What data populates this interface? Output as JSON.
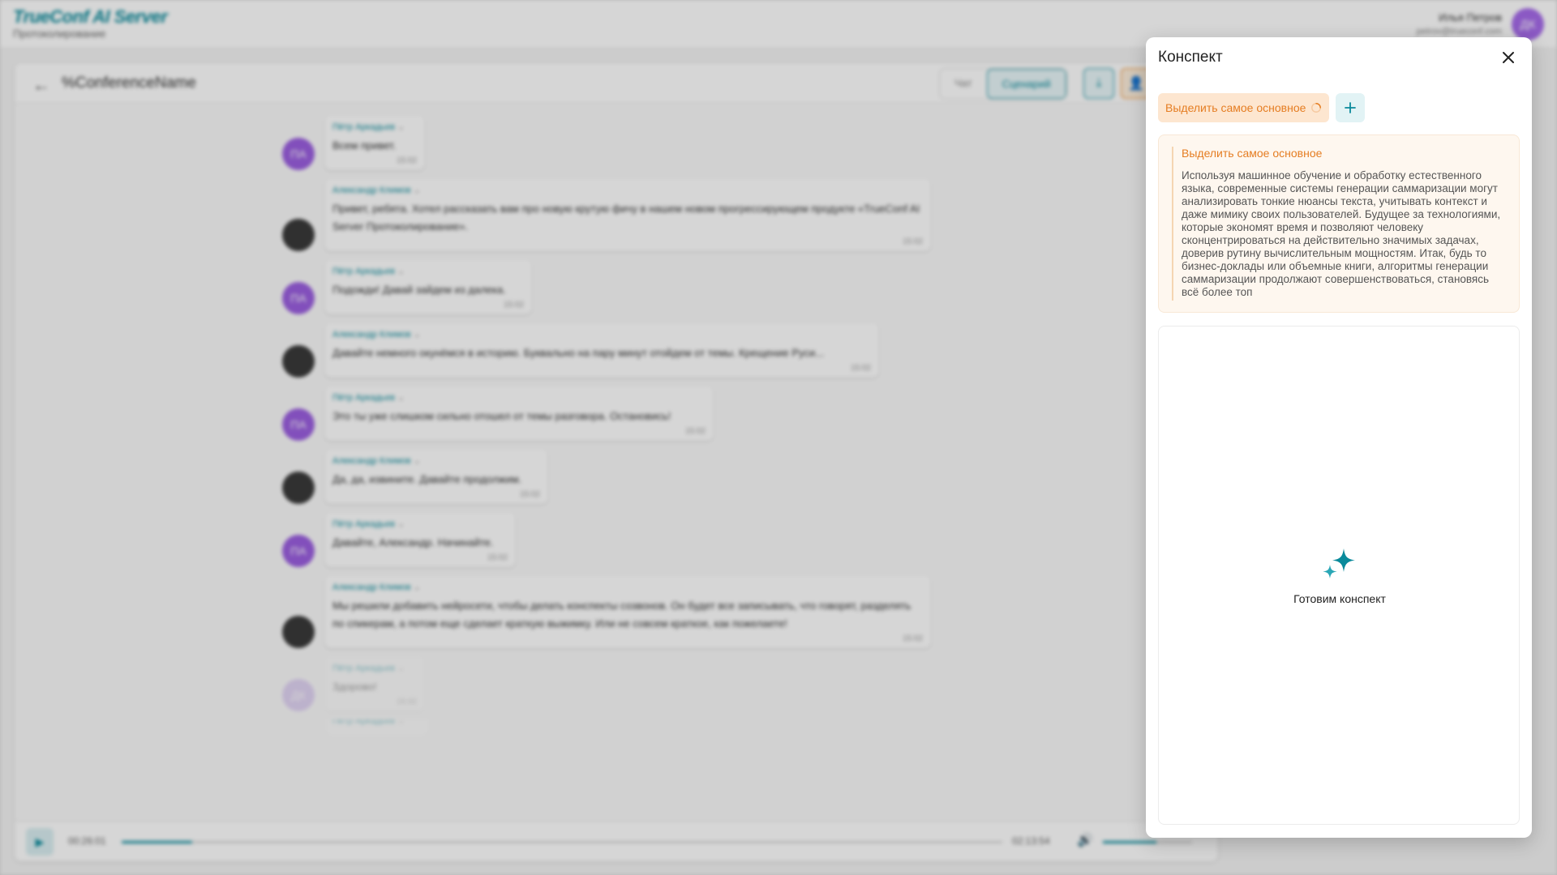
{
  "app": {
    "logo": "TrueConf AI Server",
    "subtitle": "Протоколирование"
  },
  "user": {
    "name": "Илья Петров",
    "email": "petrov@trueconf.com",
    "initials": "ДК"
  },
  "conference": {
    "title": "%ConferenceName",
    "tabs": [
      "Чат",
      "Сценарий"
    ],
    "active_tab": "Сценарий"
  },
  "messages": [
    {
      "author": "Пётр Аркадьев",
      "initials": "ПА",
      "text": "Всем привет.",
      "time": "15:02"
    },
    {
      "author": "Александр Климов",
      "initials": "",
      "text": "Привет, ребята. Хотел рассказать вам про новую крутую фичу в нашем новом прогрессирующем продукте «TrueConf AI Server Протоколирование».",
      "time": "15:02"
    },
    {
      "author": "Пётр Аркадьев",
      "initials": "ПА",
      "text": "Подожди! Давай зайдем из далека.",
      "time": "15:02"
    },
    {
      "author": "Александр Климов",
      "initials": "",
      "text": "Давайте немного окунёмся в историю. Буквально на пару минут отойдем от темы. Крещение Руси...",
      "time": "15:02"
    },
    {
      "author": "Пётр Аркадьев",
      "initials": "ПА",
      "text": "Это ты уже слишком сильно отошел от темы разговора. Остановись!",
      "time": "15:02"
    },
    {
      "author": "Александр Климов",
      "initials": "",
      "text": "Да, да, извините. Давайте продолжим.",
      "time": "15:02"
    },
    {
      "author": "Пётр Аркадьев",
      "initials": "ПА",
      "text": "Давайте, Александр. Начинайте.",
      "time": "15:02"
    },
    {
      "author": "Александр Климов",
      "initials": "",
      "text": "Мы решили добавить нейросети, чтобы делать конспекты созвонов. Он будет все записывать, что говорят, разделять по спикерам, а потом еще сделает краткую выжимку. Или не совсем краткое, как пожелаете!",
      "time": "15:02"
    },
    {
      "author": "Пётр Аркадьев",
      "initials": "ДК",
      "text": "Здорово!",
      "time": "15:02"
    },
    {
      "author": "Пётр Аркадьев",
      "initials": "",
      "text": "",
      "time": ""
    }
  ],
  "player": {
    "current_time": "00:26:01",
    "total_time": "02:13:54",
    "progress": 0.08,
    "volume": 0.6
  },
  "modal": {
    "title": "Конспект",
    "chip_label": "Выделить самое основное",
    "summary_title": "Выделить самое основное",
    "summary_text": "Используя машинное обучение и обработку естественного языка, современные системы генерации саммаризации могут анализировать тонкие нюансы текста, учитывать контекст и даже мимику своих пользователей. Будущее за технологиями, которые экономят время и позволяют человеку сконцентрироваться на действительно значимых задачах, доверив рутину вычислительным мощностям. Итак, будь то бизнес-доклады или объемные книги, алгоритмы генерации саммаризации продолжают совершенствоваться, становясь всё более топ",
    "loading_text": "Готовим конспект"
  },
  "colors": {
    "accent": "#0a8a9b",
    "orange": "#e57d22",
    "chip_bg": "#fde6d0",
    "avatar_purple": "#9b5fe0"
  },
  "icons": [
    "back-arrow-icon",
    "download-icon",
    "users-icon",
    "play-icon",
    "volume-icon",
    "close-icon",
    "spinner-icon",
    "plus-icon",
    "sparkle-icon"
  ]
}
